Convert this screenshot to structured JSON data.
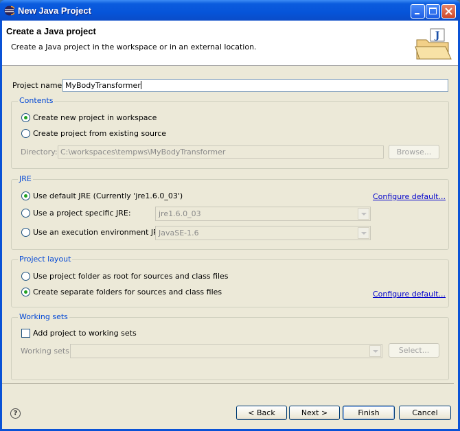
{
  "window": {
    "title": "New Java Project"
  },
  "banner": {
    "title": "Create a Java project",
    "description": "Create a Java project in the workspace or in an external location."
  },
  "project_name": {
    "label": "Project name:",
    "value": "MyBodyTransformer"
  },
  "contents": {
    "title": "Contents",
    "option_new": "Create new project in workspace",
    "option_existing": "Create project from existing source",
    "selected": "option_new",
    "directory_label": "Directory:",
    "directory_value": "C:\\workspaces\\tempws\\MyBodyTransformer",
    "browse_label": "Browse..."
  },
  "jre": {
    "title": "JRE",
    "option_default": "Use default JRE (Currently 'jre1.6.0_03')",
    "option_specific": "Use a project specific JRE:",
    "option_env": "Use an execution environment JRE:",
    "specific_value": "jre1.6.0_03",
    "env_value": "JavaSE-1.6",
    "configure_link": "Configure default...",
    "selected": "option_default"
  },
  "layout": {
    "title": "Project layout",
    "option_root": "Use project folder as root for sources and class files",
    "option_separate": "Create separate folders for sources and class files",
    "configure_link": "Configure default...",
    "selected": "option_separate"
  },
  "working_sets": {
    "title": "Working sets",
    "add_label": "Add project to working sets",
    "add_checked": false,
    "sets_label": "Working sets:",
    "sets_value": "",
    "select_label": "Select..."
  },
  "footer": {
    "help": "?",
    "back": "< Back",
    "next": "Next >",
    "finish": "Finish",
    "cancel": "Cancel"
  },
  "colors": {
    "title_bar": "#0654d9",
    "group_title": "#0046d5",
    "link": "#0000cc",
    "radio_dot": "#21a121"
  }
}
